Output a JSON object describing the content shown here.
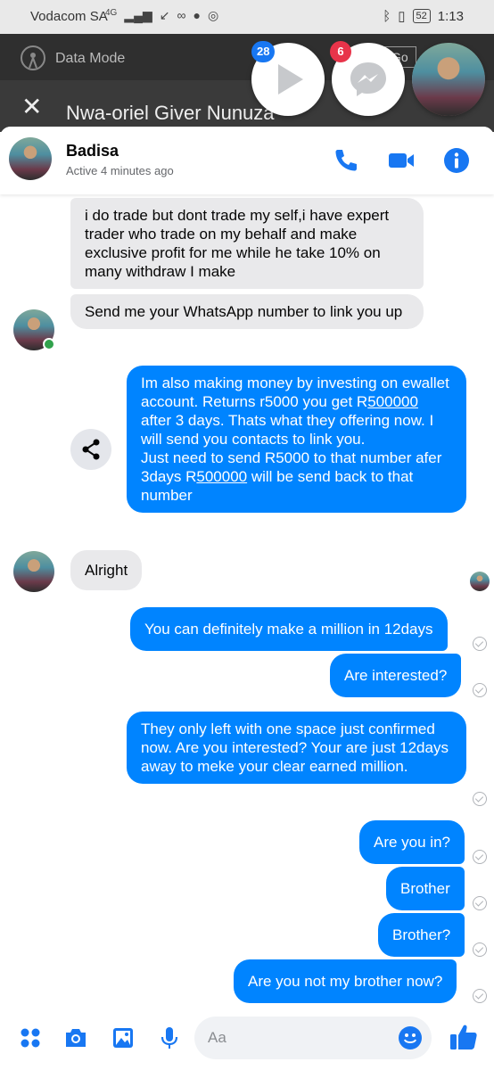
{
  "status_bar": {
    "carrier": "Vodacom SA",
    "network": "4G",
    "battery": "52",
    "time": "1:13"
  },
  "background_app": {
    "data_mode_label": "Data Mode",
    "go_label": "Go",
    "thread_title": "Nwa-oriel Giver Nunuza"
  },
  "chat_heads": {
    "video_badge": "28",
    "messenger_badge": "6"
  },
  "header": {
    "contact_name": "Badisa",
    "contact_status": "Active 4 minutes ago"
  },
  "messages": {
    "m1": "i do trade but dont trade my self,i have expert trader who  trade on my behalf and make exclusive profit for me while he take 10% on many withdraw I make",
    "m2": "Send me your WhatsApp number to link you up",
    "m3": {
      "p1": "Im also making money by investing on ewallet account. Returns r5000 you get R",
      "p2": "500000",
      "p3": " after 3 days. Thats what they offering now. I will send you contacts to link you.",
      "p4": "Just need to send R5000 to that number afer 3days R",
      "p5": "500000",
      "p6": " will be send back to that number"
    },
    "m4": "Alright",
    "m5": "You can definitely make a million in 12days",
    "m6": "Are interested?",
    "m7": "They only left with one space just confirmed now. Are you interested? Your are just 12days away to meke your clear earned million.",
    "m8": "Are you in?",
    "m9": "Brother",
    "m10": "Brother?",
    "m11": "Are you not my brother now?"
  },
  "composer": {
    "placeholder": "Aa"
  },
  "colors": {
    "accent": "#0084ff",
    "header_icons": "#1877f2",
    "incoming_bubble": "#e9e9eb",
    "online": "#31a24c"
  }
}
